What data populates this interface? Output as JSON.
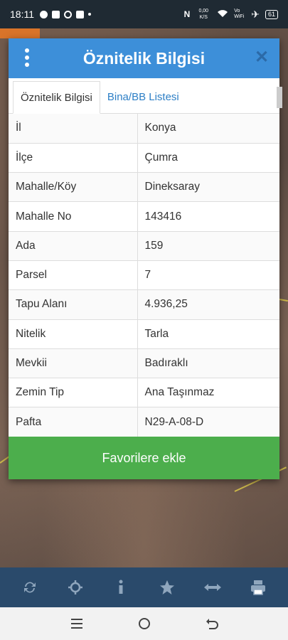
{
  "status_bar": {
    "time": "18:11",
    "net_speed": "0,00 K/S",
    "volte": "Vo WiFi",
    "battery": "61"
  },
  "dialog": {
    "title": "Öznitelik Bilgisi",
    "tabs": [
      {
        "label": "Öznitelik Bilgisi",
        "active": true
      },
      {
        "label": "Bina/BB Listesi",
        "active": false
      }
    ],
    "rows": [
      {
        "key": "İl",
        "value": "Konya"
      },
      {
        "key": "İlçe",
        "value": "Çumra"
      },
      {
        "key": "Mahalle/Köy",
        "value": "Dineksaray"
      },
      {
        "key": "Mahalle No",
        "value": "143416"
      },
      {
        "key": "Ada",
        "value": "159"
      },
      {
        "key": "Parsel",
        "value": "7"
      },
      {
        "key": "Tapu Alanı",
        "value": "4.936,25"
      },
      {
        "key": "Nitelik",
        "value": "Tarla"
      },
      {
        "key": "Mevkii",
        "value": "Badıraklı"
      },
      {
        "key": "Zemin Tip",
        "value": "Ana Taşınmaz"
      },
      {
        "key": "Pafta",
        "value": "N29-A-08-D"
      }
    ],
    "favorite_button": "Favorilere ekle"
  },
  "toolbar": {
    "items": [
      "refresh-icon",
      "locate-icon",
      "info-icon",
      "star-icon",
      "measure-icon",
      "print-icon"
    ]
  },
  "nav": {
    "items": [
      "menu-icon",
      "home-icon",
      "back-icon"
    ]
  },
  "colors": {
    "header_blue": "#3d8fd9",
    "tab_link_blue": "#2d7fc6",
    "favorite_green": "#4cae4c",
    "toolbar_navy": "#2a4a6b"
  }
}
